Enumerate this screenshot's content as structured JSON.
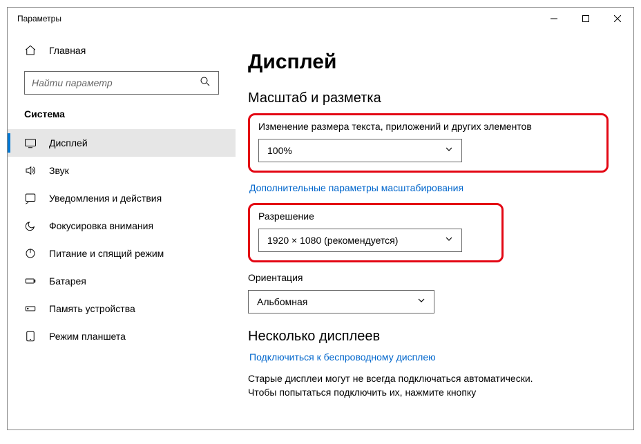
{
  "window": {
    "title": "Параметры"
  },
  "sidebar": {
    "home": "Главная",
    "search_placeholder": "Найти параметр",
    "section": "Система",
    "items": [
      {
        "label": "Дисплей"
      },
      {
        "label": "Звук"
      },
      {
        "label": "Уведомления и действия"
      },
      {
        "label": "Фокусировка внимания"
      },
      {
        "label": "Питание и спящий режим"
      },
      {
        "label": "Батарея"
      },
      {
        "label": "Память устройства"
      },
      {
        "label": "Режим планшета"
      }
    ]
  },
  "main": {
    "title": "Дисплей",
    "scale_section": "Масштаб и разметка",
    "scale_label": "Изменение размера текста, приложений и других элементов",
    "scale_value": "100%",
    "advanced_link": "Дополнительные параметры масштабирования",
    "res_label": "Разрешение",
    "res_value": "1920 × 1080 (рекомендуется)",
    "orient_label": "Ориентация",
    "orient_value": "Альбомная",
    "multi_section": "Несколько дисплеев",
    "connect_link": "Подключиться к беспроводному дисплею",
    "old_para1": "Старые дисплеи могут не всегда подключаться автоматически.",
    "old_para2": "Чтобы попытаться подключить их, нажмите кнопку"
  }
}
